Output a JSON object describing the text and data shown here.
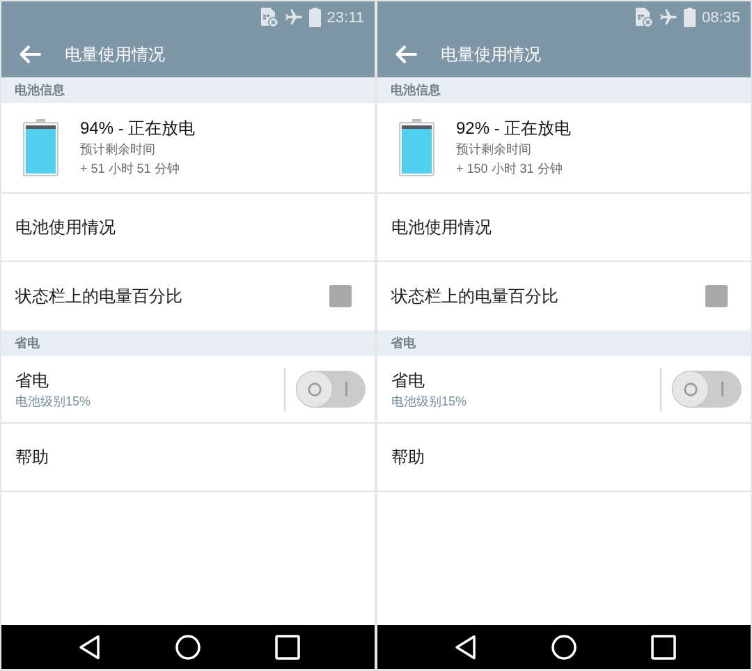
{
  "screens": [
    {
      "status_bar": {
        "time": "23:11"
      },
      "toolbar": {
        "title": "电量使用情况"
      },
      "sections": [
        {
          "header": "电池信息",
          "items": [
            {
              "kind": "battery",
              "title": "94% - 正在放电",
              "lines": [
                "预计剩余时间",
                "+ 51 小时 51 分钟"
              ]
            },
            {
              "kind": "link",
              "title": "电池使用情况"
            },
            {
              "kind": "checkbox",
              "title": "状态栏上的电量百分比",
              "checked": false
            }
          ]
        },
        {
          "header": "省电",
          "items": [
            {
              "kind": "switch",
              "title": "省电",
              "subtitle": "电池级别15%",
              "on": false
            },
            {
              "kind": "link",
              "title": "帮助"
            }
          ]
        }
      ]
    },
    {
      "status_bar": {
        "time": "08:35"
      },
      "toolbar": {
        "title": "电量使用情况"
      },
      "sections": [
        {
          "header": "电池信息",
          "items": [
            {
              "kind": "battery",
              "title": "92% - 正在放电",
              "lines": [
                "预计剩余时间",
                "+ 150 小时 31 分钟"
              ]
            },
            {
              "kind": "link",
              "title": "电池使用情况"
            },
            {
              "kind": "checkbox",
              "title": "状态栏上的电量百分比",
              "checked": false
            }
          ]
        },
        {
          "header": "省电",
          "items": [
            {
              "kind": "switch",
              "title": "省电",
              "subtitle": "电池级别15%",
              "on": false
            },
            {
              "kind": "link",
              "title": "帮助"
            }
          ]
        }
      ]
    }
  ]
}
